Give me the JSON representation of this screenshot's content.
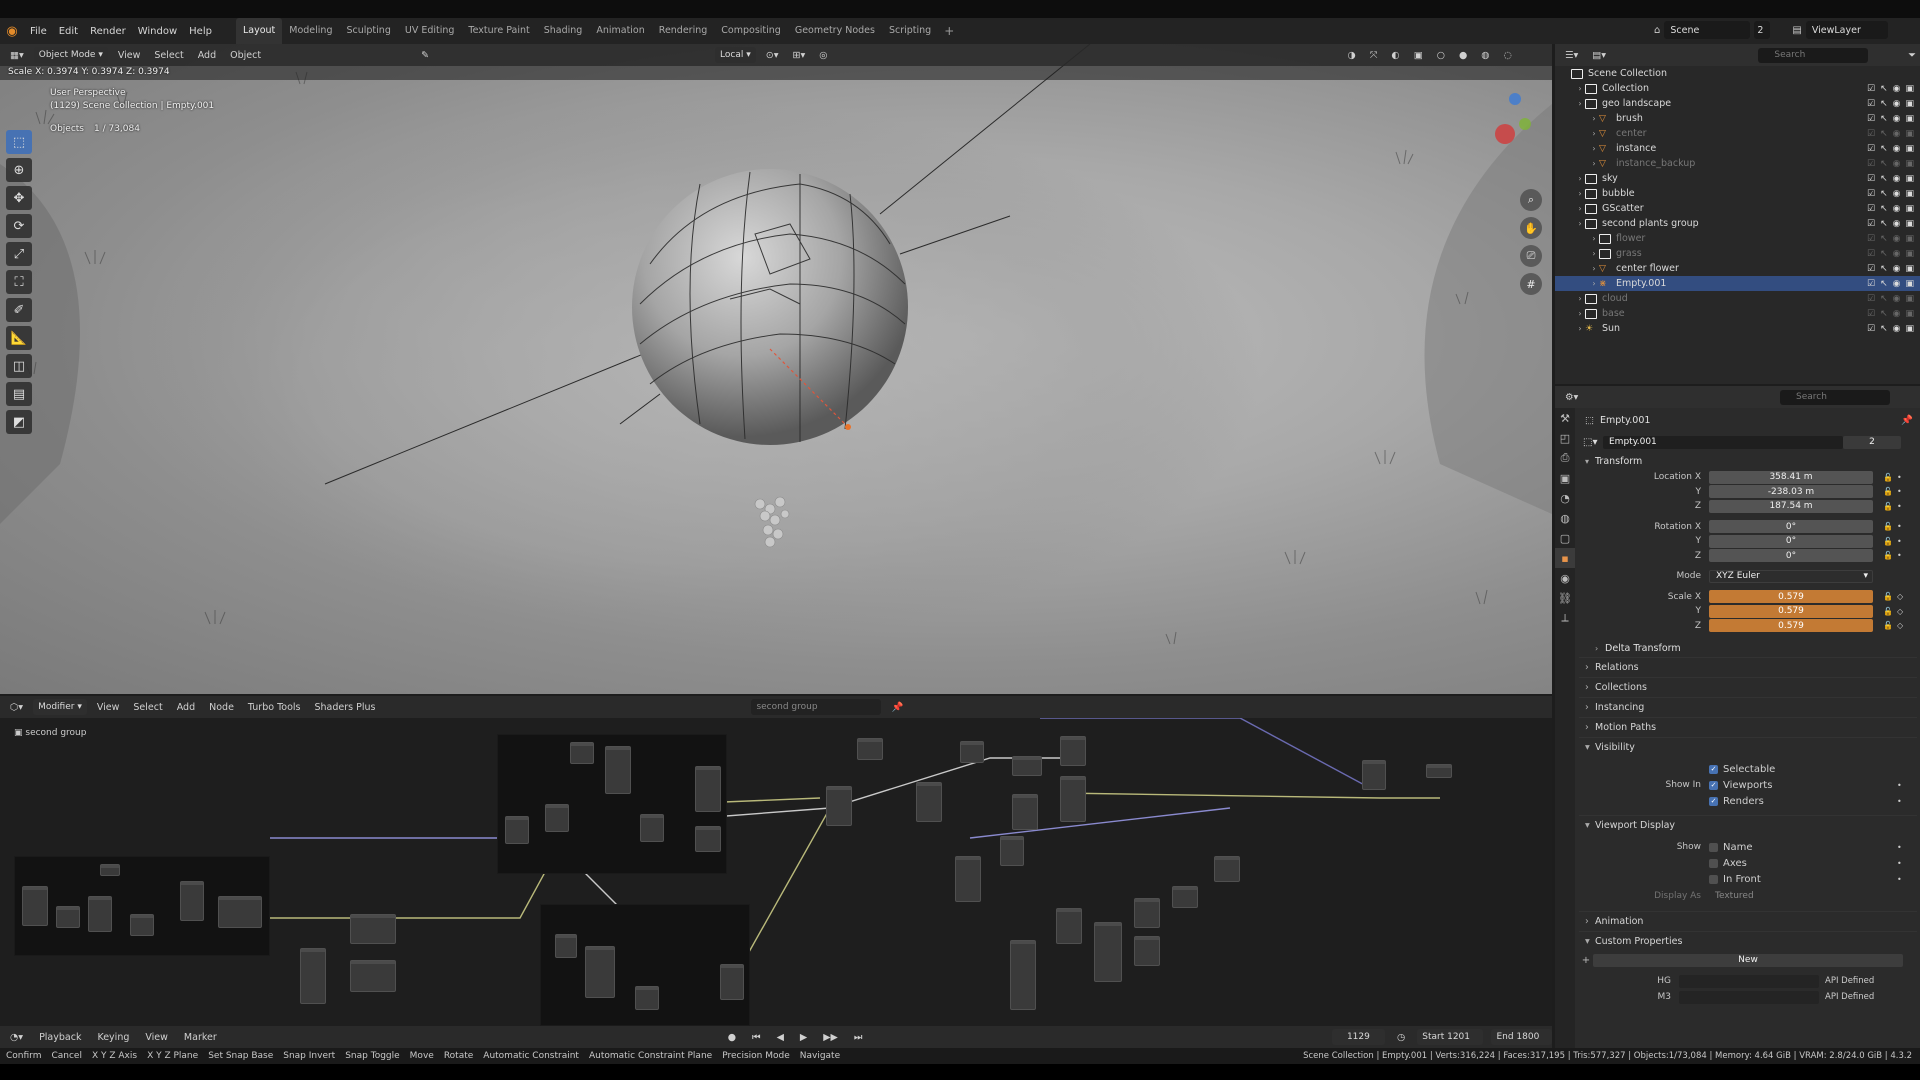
{
  "menu": {
    "items": [
      "File",
      "Edit",
      "Render",
      "Window",
      "Help"
    ],
    "workspaces": [
      "Layout",
      "Modeling",
      "Sculpting",
      "UV Editing",
      "Texture Paint",
      "Shading",
      "Animation",
      "Rendering",
      "Compositing",
      "Geometry Nodes",
      "Scripting"
    ],
    "active_workspace": "Layout",
    "add_tab": "+",
    "scene_label": "Scene",
    "scene_count": "2",
    "view_layer": "ViewLayer"
  },
  "viewport": {
    "mode": "Object Mode",
    "menu": [
      "View",
      "Select",
      "Add",
      "Object"
    ],
    "transform_orientation": "Local",
    "scale_readout": "Scale X: 0.3974   Y: 0.3974   Z: 0.3974",
    "perspective_label": "User Perspective",
    "collection_path": "(1129) Scene Collection | Empty.001",
    "objects_label": "Objects",
    "objects_count": "1 / 73,084"
  },
  "node_editor": {
    "mode": "Modifier",
    "menu": [
      "View",
      "Select",
      "Add",
      "Node",
      "Turbo Tools",
      "Shaders Plus"
    ],
    "node_group": "second group",
    "breadcrumb": "second group"
  },
  "timeline": {
    "menu": [
      "Playback",
      "Keying",
      "View",
      "Marker"
    ],
    "current_frame": "1129",
    "start": "Start 1201",
    "end": "End 1800"
  },
  "statusbar": {
    "items": [
      "Confirm",
      "Cancel",
      "X Y Z Axis",
      "X Y Z Plane",
      "Set Snap Base",
      "Snap Invert",
      "Snap Toggle",
      "Move",
      "Rotate",
      "Automatic Constraint",
      "Automatic Constraint Plane",
      "Precision Mode",
      "Navigate"
    ],
    "stats": "Scene Collection | Empty.001 | Verts:316,224 | Faces:317,195 | Tris:577,327 | Objects:1/73,084 | Memory: 4.64 GiB | VRAM: 2.8/24.0 GiB | 4.3.2"
  },
  "outliner": {
    "search_placeholder": "Search",
    "rows": [
      {
        "label": "Scene Collection",
        "indent": 0,
        "kind": "scene",
        "state": "normal"
      },
      {
        "label": "Collection",
        "indent": 1,
        "kind": "collection",
        "state": "normal"
      },
      {
        "label": "geo landscape",
        "indent": 1,
        "kind": "collection",
        "state": "normal"
      },
      {
        "label": "brush",
        "indent": 2,
        "kind": "object",
        "state": "normal"
      },
      {
        "label": "center",
        "indent": 2,
        "kind": "object",
        "state": "dim"
      },
      {
        "label": "instance",
        "indent": 2,
        "kind": "object",
        "state": "normal"
      },
      {
        "label": "instance_backup",
        "indent": 2,
        "kind": "object",
        "state": "dim"
      },
      {
        "label": "sky",
        "indent": 1,
        "kind": "collection",
        "state": "normal"
      },
      {
        "label": "bubble",
        "indent": 1,
        "kind": "collection",
        "state": "normal"
      },
      {
        "label": "GScatter",
        "indent": 1,
        "kind": "collection",
        "state": "normal"
      },
      {
        "label": "second plants group",
        "indent": 1,
        "kind": "collection",
        "state": "normal"
      },
      {
        "label": "flower",
        "indent": 2,
        "kind": "collection",
        "state": "dim"
      },
      {
        "label": "grass",
        "indent": 2,
        "kind": "collection",
        "state": "dim"
      },
      {
        "label": "center flower",
        "indent": 2,
        "kind": "object",
        "state": "normal"
      },
      {
        "label": "Empty.001",
        "indent": 2,
        "kind": "empty",
        "state": "selected"
      },
      {
        "label": "cloud",
        "indent": 1,
        "kind": "collection",
        "state": "dim"
      },
      {
        "label": "base",
        "indent": 1,
        "kind": "collection",
        "state": "dim"
      },
      {
        "label": "Sun",
        "indent": 1,
        "kind": "light",
        "state": "normal"
      }
    ]
  },
  "properties": {
    "search_placeholder": "Search",
    "object_name_header": "Empty.001",
    "object_name_field": "Empty.001",
    "users_count": "2",
    "transform_title": "Transform",
    "location_label": "Location X",
    "location": [
      "358.41 m",
      "-238.03 m",
      "187.54 m"
    ],
    "rotation_label": "Rotation X",
    "rotation": [
      "0°",
      "0°",
      "0°"
    ],
    "axis_y": "Y",
    "axis_z": "Z",
    "mode_label": "Mode",
    "mode_value": "XYZ Euler",
    "scale_label": "Scale X",
    "scale": [
      "0.579",
      "0.579",
      "0.579"
    ],
    "delta_transform": "Delta Transform",
    "collapsed_panels": [
      "Relations",
      "Collections",
      "Instancing",
      "Motion Paths"
    ],
    "visibility_title": "Visibility",
    "selectable": "Selectable",
    "show_in_label": "Show In",
    "viewports": "Viewports",
    "renders": "Renders",
    "viewport_display_title": "Viewport Display",
    "show_label": "Show",
    "show_name": "Name",
    "show_axes": "Axes",
    "show_infront": "In Front",
    "display_as_label": "Display As",
    "display_as_value": "Textured",
    "animation_title": "Animation",
    "custom_props_title": "Custom Properties",
    "new_button": "New",
    "prop1_label": "HG",
    "prop1_value": "API Defined",
    "prop2_label": "M3",
    "prop2_value": "API Defined"
  },
  "colors": {
    "accent": "#4772b3",
    "selection_orange": "#c37a34",
    "object_orange": "#e3913a"
  }
}
